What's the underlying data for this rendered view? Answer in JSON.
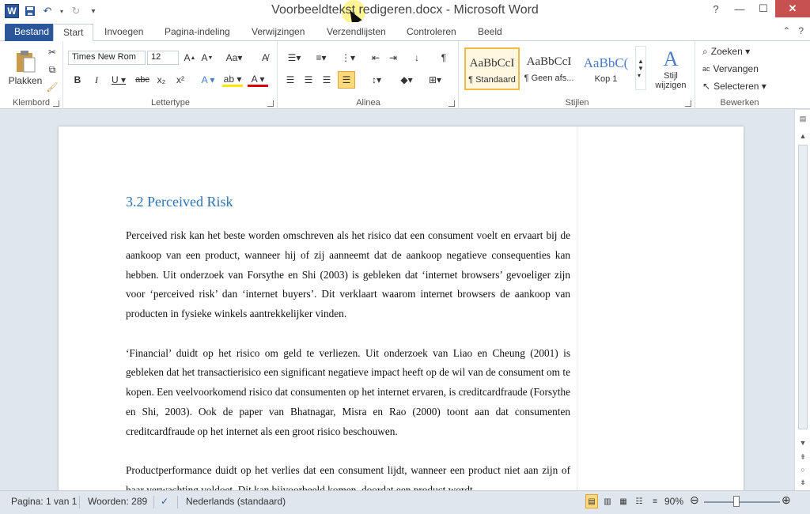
{
  "window": {
    "title": "Voorbeeldtekst redigeren.docx - Microsoft Word",
    "app_logo": "W"
  },
  "tabs": {
    "file": "Bestand",
    "items": [
      "Start",
      "Invoegen",
      "Pagina-indeling",
      "Verwijzingen",
      "Verzendlijsten",
      "Controleren",
      "Beeld"
    ]
  },
  "ribbon": {
    "clipboard": {
      "paste": "Plakken",
      "label": "Klembord"
    },
    "font": {
      "name": "Times New Rom",
      "size": "12",
      "label": "Lettertype"
    },
    "paragraph": {
      "label": "Alinea"
    },
    "styles": {
      "label": "Stijlen",
      "items": [
        {
          "sample": "AaBbCcI",
          "name": "¶ Standaard"
        },
        {
          "sample": "AaBbCcI",
          "name": "¶ Geen afs..."
        },
        {
          "sample": "AaBbC(",
          "name": "Kop 1"
        }
      ],
      "change": "Stijl wijzigen"
    },
    "editing": {
      "label": "Bewerken",
      "find": "Zoeken",
      "replace": "Vervangen",
      "select": "Selecteren"
    }
  },
  "document": {
    "heading": "3.2 Perceived Risk",
    "paragraphs": [
      "Perceived risk kan het beste worden omschreven als het risico dat een consument voelt en ervaart bij de aankoop van een product, wanneer hij of zij aanneemt dat de aankoop negatieve consequenties kan hebben. Uit onderzoek van Forsythe en Shi (2003) is gebleken dat ‘internet browsers’ gevoeliger zijn voor ‘perceived risk’ dan ‘internet buyers’. Dit verklaart waarom internet browsers de aankoop van producten in fysieke winkels aantrekkelijker vinden.",
      "‘Financial’ duidt op het risico om geld te verliezen. Uit onderzoek van Liao en Cheung (2001) is gebleken dat het transactierisico een significant negatieve impact heeft op de wil van de consument om te kopen. Een veelvoorkomend risico dat consumenten op het internet ervaren, is creditcardfraude (Forsythe en Shi, 2003). Ook de paper van Bhatnagar, Misra en Rao (2000) toont aan dat consumenten creditcardfraude op het internet als een groot risico beschouwen.",
      "Productperformance duidt op het verlies dat een consument lijdt, wanneer een product niet aan zijn of haar verwachting voldoet. Dit kan bijvoorbeeld komen, doordat een product wordt"
    ]
  },
  "status": {
    "page": "Pagina: 1 van 1",
    "words": "Woorden: 289",
    "language": "Nederlands (standaard)",
    "zoom": "90%",
    "zoom_level": 0.9
  }
}
